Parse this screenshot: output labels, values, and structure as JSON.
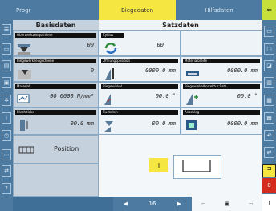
{
  "tabs": {
    "progr": "Progr",
    "biegedaten": "Biegedaten",
    "hilfsdaten": "Hilfsdaten"
  },
  "headers": {
    "basisdaten": "Basisdaten",
    "satzdaten": "Satzdaten"
  },
  "cells": {
    "oberwerkzeug": {
      "label": "Oberwerkzeugschiene",
      "value": "00"
    },
    "zyklus": {
      "label": "Zyklus",
      "value": "00"
    },
    "unterwerkzeug": {
      "label": "Biegewerkzeugschiene",
      "value": "0"
    },
    "oeffnung": {
      "label": "Öffnungsposition",
      "value": "0000.0 mm"
    },
    "material": {
      "label": "Materialbreite",
      "value": "0000.0 mm"
    },
    "materialtyp": {
      "label": "Material",
      "value": "00 0000 N/mm²"
    },
    "biegewinkel": {
      "label": "Biegewinkel",
      "value": "00.0 °"
    },
    "winkelkorrektur": {
      "label": "Biegewinkelkorrektur Satz",
      "value": "00.0 °"
    },
    "blechdicke": {
      "label": "Blechdicke",
      "value": "00.0 mm"
    },
    "zustellung": {
      "label": "Zustellen",
      "value": "00.0 mm"
    },
    "anschlag": {
      "label": "Anschlag",
      "value": "0000.0 mm"
    },
    "position": {
      "label": "Position"
    }
  },
  "info_label": "i",
  "page_number": "16",
  "right_red_label": "0",
  "right_bottom_label": "I",
  "colors": {
    "tab_active": "#f5e642",
    "tab_blue": "#4c7aa1",
    "accent_green": "#c8e03a",
    "red": "#d42b1e"
  }
}
